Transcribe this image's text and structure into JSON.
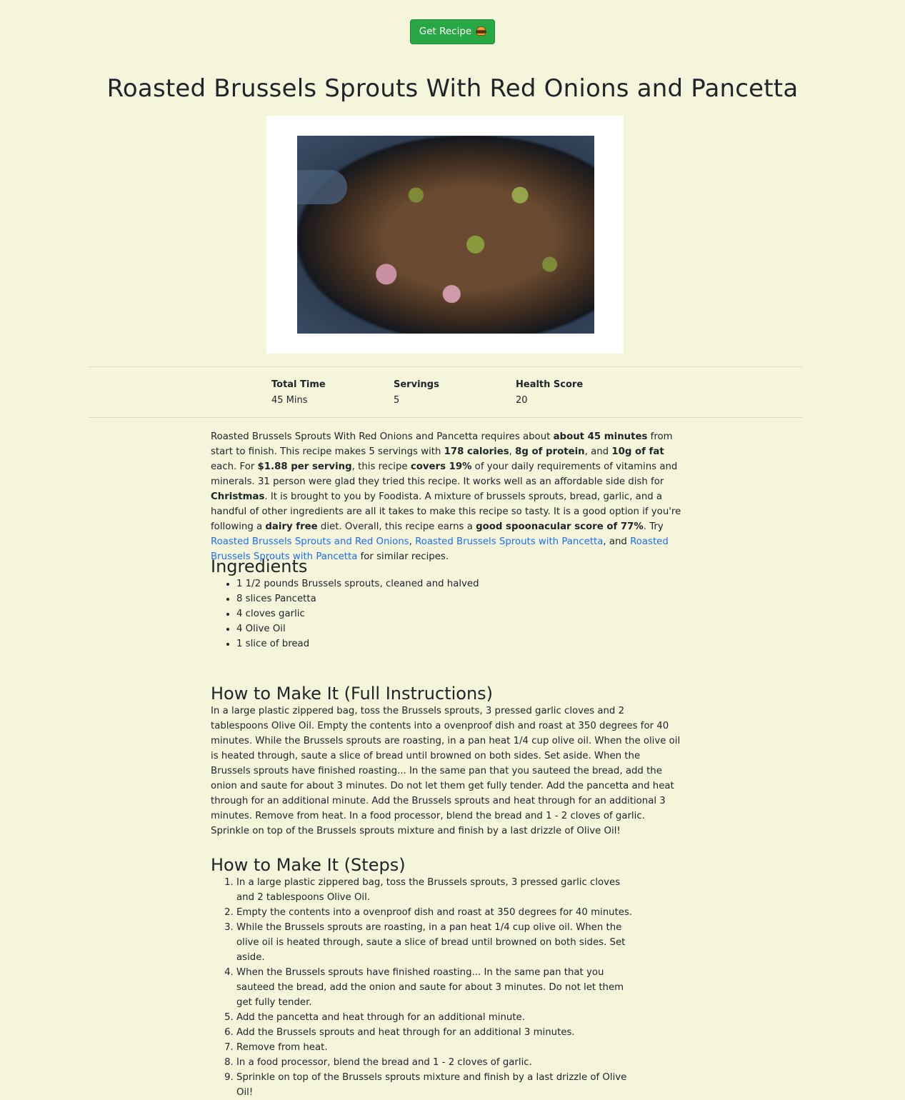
{
  "header": {
    "button_label": "Get Recipe",
    "button_icon": "hamburger-emoji"
  },
  "recipe": {
    "title": "Roasted Brussels Sprouts With Red Onions and Pancetta",
    "stats": [
      {
        "label": "Total Time",
        "value": "45 Mins"
      },
      {
        "label": "Servings",
        "value": "5"
      },
      {
        "label": "Health Score",
        "value": "20"
      }
    ],
    "summary": {
      "t1": "Roasted Brussels Sprouts With Red Onions and Pancetta requires about ",
      "b1": "about 45 minutes",
      "t2": " from start to finish. This recipe makes 5 servings with ",
      "b2": "178 calories",
      "t3": ", ",
      "b3": "8g of protein",
      "t4": ", and ",
      "b4": "10g of fat",
      "t5": " each. For ",
      "b5": "$1.88 per serving",
      "t6": ", this recipe ",
      "b6": "covers 19%",
      "t7": " of your daily requirements of vitamins and minerals. 31 person were glad they tried this recipe. It works well as an affordable side dish for ",
      "b7": "Christmas",
      "t8": ". It is brought to you by Foodista. A mixture of brussels sprouts, bread, garlic, and a handful of other ingredients are all it takes to make this recipe so tasty. It is a good option if you're following a ",
      "b8": "dairy free",
      "t9": " diet. Overall, this recipe earns a ",
      "b9": "good spoonacular score of 77%",
      "t10": ". Try ",
      "link1": "Roasted Brussels Sprouts and Red Onions",
      "t11": ", ",
      "link2": "Roasted Brussels Sprouts with Pancetta",
      "t12": ", and ",
      "link3": "Roasted Brussels Sprouts with Pancetta",
      "t13": " for similar recipes."
    },
    "ingredients_heading": "Ingredients",
    "ingredients": [
      "1 1/2 pounds Brussels sprouts, cleaned and halved",
      "8 slices Pancetta",
      "4 cloves garlic",
      "4 Olive Oil",
      "1 slice of bread"
    ],
    "full_heading": "How to Make It (Full Instructions)",
    "full_instructions": "In a large plastic zippered bag, toss the Brussels sprouts, 3 pressed garlic cloves and 2 tablespoons Olive Oil. Empty the contents into a ovenproof dish and roast at 350 degrees for 40 minutes. While the Brussels sprouts are roasting, in a pan heat 1/4 cup olive oil. When the olive oil is heated through, saute a slice of bread until browned on both sides. Set aside. When the Brussels sprouts have finished roasting... In the same pan that you sauteed the bread, add the onion and saute for about 3 minutes. Do not let them get fully tender. Add the pancetta and heat through for an additional minute. Add the Brussels sprouts and heat through for an additional 3 minutes. Remove from heat. In a food processor, blend the bread and 1 - 2 cloves of garlic. Sprinkle on top of the Brussels sprouts mixture and finish by a last drizzle of Olive Oil!",
    "steps_heading": "How to Make It (Steps)",
    "steps": [
      "In a large plastic zippered bag, toss the Brussels sprouts, 3 pressed garlic cloves and 2 tablespoons Olive Oil.",
      "Empty the contents into a ovenproof dish and roast at 350 degrees for 40 minutes.",
      "While the Brussels sprouts are roasting, in a pan heat 1/4 cup olive oil. When the olive oil is heated through, saute a slice of bread until browned on both sides. Set aside.",
      "When the Brussels sprouts have finished roasting... In the same pan that you sauteed the bread, add the onion and saute for about 3 minutes. Do not let them get fully tender.",
      "Add the pancetta and heat through for an additional minute.",
      "Add the Brussels sprouts and heat through for an additional 3 minutes.",
      "Remove from heat.",
      "In a food processor, blend the bread and 1 - 2 cloves of garlic.",
      "Sprinkle on top of the Brussels sprouts mixture and finish by a last drizzle of Olive Oil!"
    ]
  },
  "colors": {
    "background": "#f5f5dc",
    "button": "#28a745",
    "link": "#1b6ff2",
    "text": "#212529"
  }
}
